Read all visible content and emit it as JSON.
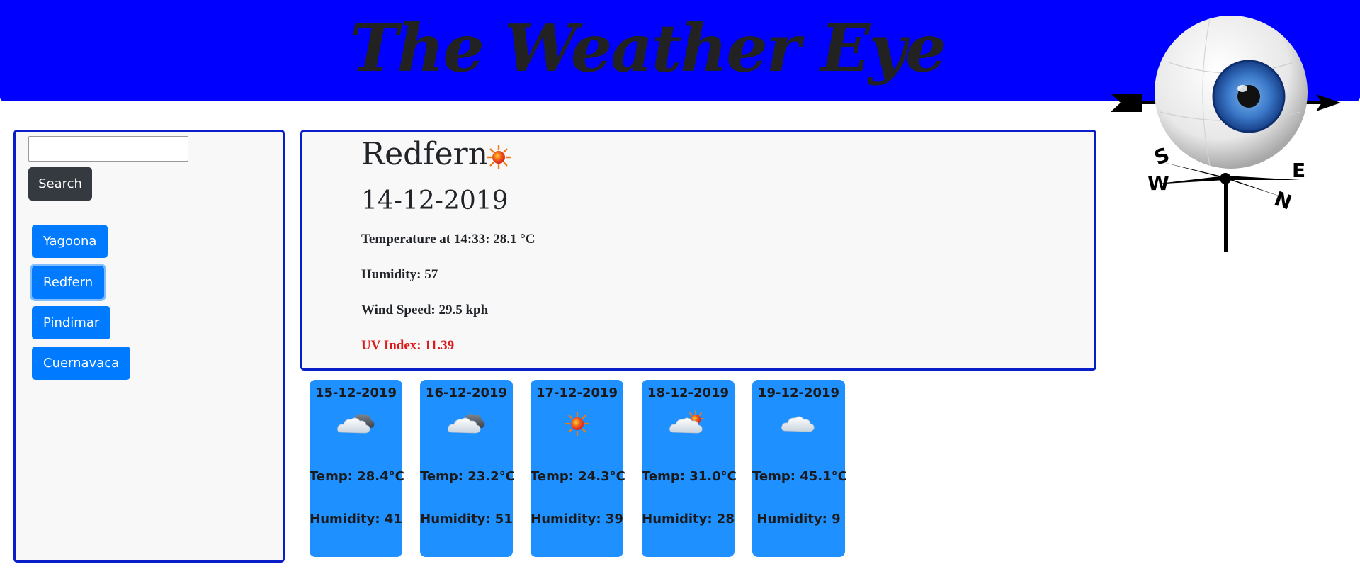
{
  "header": {
    "title": "The Weather Eye",
    "background_color": "#0000ff",
    "logo_icon": "weather-vane-eye-icon"
  },
  "sidebar": {
    "search": {
      "value": "",
      "placeholder": ""
    },
    "search_label": "Search",
    "cities": [
      {
        "label": "Yagoona",
        "active": false
      },
      {
        "label": "Redfern",
        "active": true
      },
      {
        "label": "Pindimar",
        "active": false
      },
      {
        "label": "Cuernavaca",
        "active": false
      }
    ]
  },
  "current": {
    "city": "Redfern",
    "icon": "sunny-icon",
    "date": "14-12-2019",
    "temperature": "Temperature at 14:33: 28.1 °C",
    "humidity": "Humidity: 57",
    "wind_speed": "Wind Speed: 29.5 kph",
    "uv_index": "UV Index: 11.39",
    "uv_color": "#dc1a1a"
  },
  "forecast": [
    {
      "date": "15-12-2019",
      "icon": "partly-cloudy-icon",
      "temp": "Temp: 28.4°C",
      "humidity": "Humidity: 41"
    },
    {
      "date": "16-12-2019",
      "icon": "partly-cloudy-icon",
      "temp": "Temp: 23.2°C",
      "humidity": "Humidity: 51"
    },
    {
      "date": "17-12-2019",
      "icon": "sunny-icon",
      "temp": "Temp: 24.3°C",
      "humidity": "Humidity: 39"
    },
    {
      "date": "18-12-2019",
      "icon": "sun-behind-cloud-icon",
      "temp": "Temp: 31.0°C",
      "humidity": "Humidity: 28"
    },
    {
      "date": "19-12-2019",
      "icon": "cloud-icon",
      "temp": "Temp: 45.1°C",
      "humidity": "Humidity: 9"
    }
  ],
  "colors": {
    "accent_border": "#0a1ec8",
    "city_button": "#007bff",
    "search_button": "#343a40",
    "forecast_card": "#1e90ff"
  }
}
